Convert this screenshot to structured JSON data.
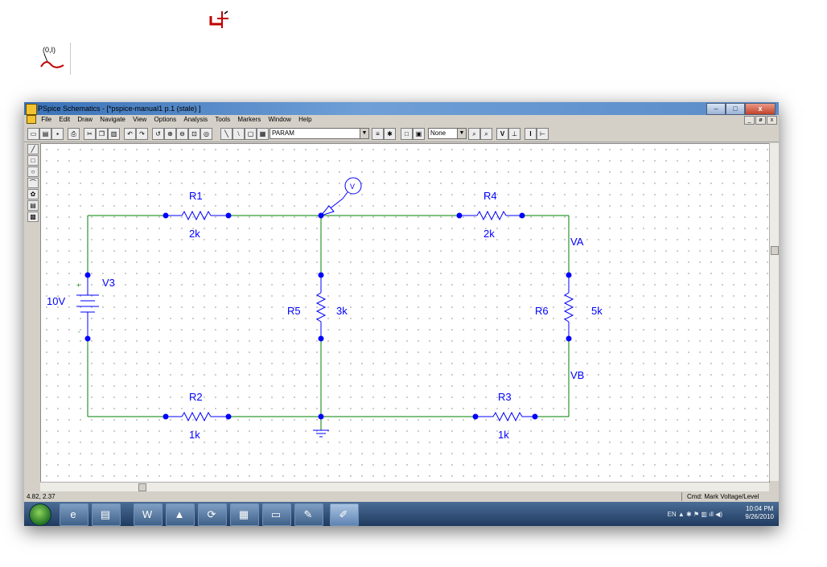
{
  "window": {
    "title": "PSpice Schematics - [*pspice-manual1  p.1 (stale) ]",
    "controls": {
      "minimize": "–",
      "maximize": "□",
      "close": "x"
    },
    "mdi_controls": {
      "minimize": "_",
      "restore": "ø",
      "close": "x"
    }
  },
  "menu": [
    "File",
    "Edit",
    "Draw",
    "Navigate",
    "View",
    "Options",
    "Analysis",
    "Tools",
    "Markers",
    "Window",
    "Help"
  ],
  "toolbar": {
    "part_combo": "PARAM",
    "none_combo": "None",
    "v_button": "V",
    "i_button": "I"
  },
  "schematic": {
    "parts": [
      {
        "ref": "R1",
        "value": "2k"
      },
      {
        "ref": "R4",
        "value": "2k"
      },
      {
        "ref": "R5",
        "value": "3k"
      },
      {
        "ref": "R6",
        "value": "5k"
      },
      {
        "ref": "R2",
        "value": "1k"
      },
      {
        "ref": "R3",
        "value": "1k"
      },
      {
        "ref": "V3",
        "value": "10V"
      }
    ],
    "node_labels": {
      "va": "VA",
      "vb": "VB"
    },
    "marker_label": "V",
    "polarity": {
      "plus": "+",
      "minus": "-"
    }
  },
  "status": {
    "coords": "4.82, 2.37",
    "cmd": "Cmd: Mark Voltage/Level"
  },
  "taskbar": {
    "language": "EN",
    "time": "10:04 PM",
    "date": "9/26/2010"
  },
  "colors": {
    "wire": "#008000",
    "part": "#0000ff",
    "label": "#0000ff",
    "pin": "#0000ff"
  }
}
